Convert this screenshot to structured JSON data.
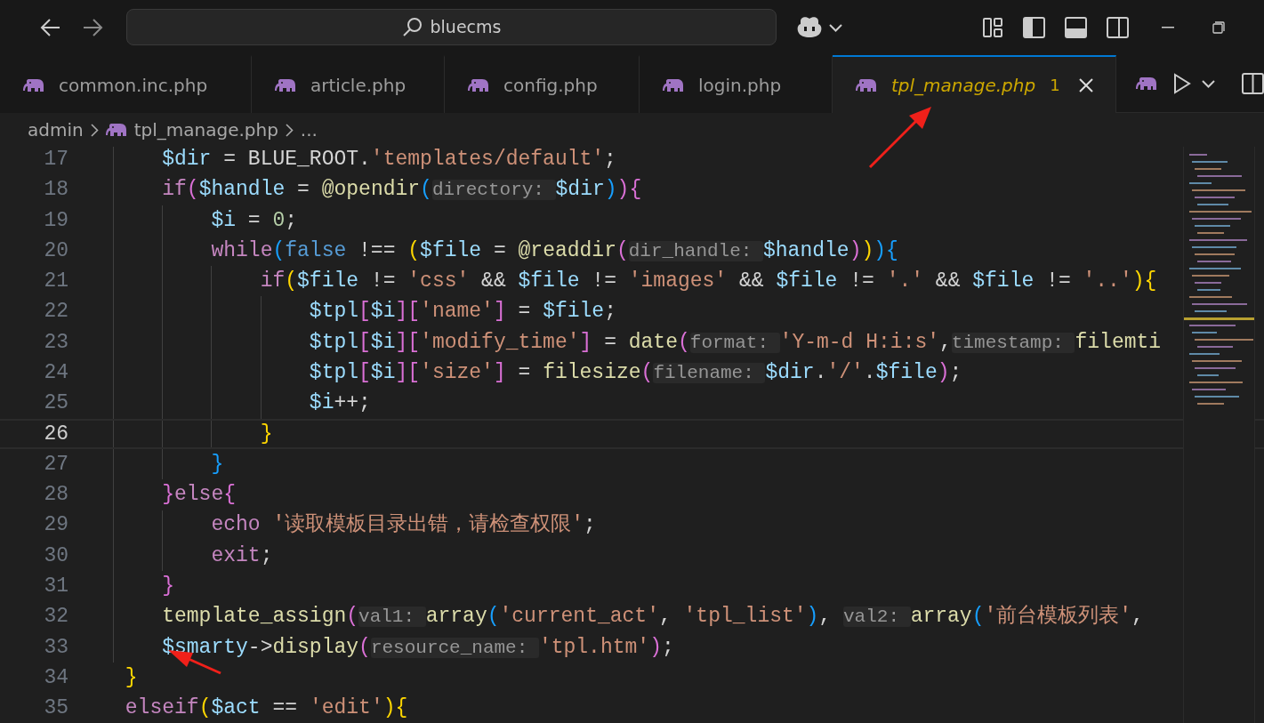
{
  "title_bar": {
    "search": {
      "label": "bluecms"
    }
  },
  "tabs": [
    {
      "label": "common.inc.php",
      "selected": false,
      "preview": false
    },
    {
      "label": "article.php",
      "selected": false,
      "preview": false
    },
    {
      "label": "config.php",
      "selected": false,
      "preview": false
    },
    {
      "label": "login.php",
      "selected": false,
      "preview": false
    },
    {
      "label": "tpl_manage.php",
      "selected": true,
      "preview": true,
      "problems": "1"
    }
  ],
  "breadcrumb": [
    {
      "kind": "folder",
      "label": "admin"
    },
    {
      "kind": "file",
      "label": "tpl_manage.php"
    },
    {
      "kind": "more",
      "label": "..."
    }
  ],
  "editor": {
    "lines": [
      {
        "number": "17",
        "current": false,
        "tokens": [
          {
            "kind": "var",
            "text": "    $dir"
          },
          {
            "kind": "plain",
            "text": " = BLUE_ROOT."
          },
          {
            "kind": "str",
            "text": "'templates/default'"
          },
          {
            "kind": "plain",
            "text": ";"
          }
        ]
      },
      {
        "number": "18",
        "current": false,
        "tokens": [
          {
            "kind": "kw",
            "text": "    if"
          },
          {
            "kind": "b2",
            "text": "("
          },
          {
            "kind": "var",
            "text": "$handle"
          },
          {
            "kind": "plain",
            "text": " = "
          },
          {
            "kind": "fn",
            "text": "@opendir"
          },
          {
            "kind": "b3",
            "text": "("
          },
          {
            "kind": "hint",
            "text": "directory: "
          },
          {
            "kind": "var",
            "text": "$dir"
          },
          {
            "kind": "b3",
            "text": ")"
          },
          {
            "kind": "b2",
            "text": "){"
          }
        ]
      },
      {
        "number": "19",
        "current": false,
        "tokens": [
          {
            "kind": "var",
            "text": "        $i"
          },
          {
            "kind": "plain",
            "text": " = "
          },
          {
            "kind": "num",
            "text": "0"
          },
          {
            "kind": "plain",
            "text": ";"
          }
        ]
      },
      {
        "number": "20",
        "current": false,
        "tokens": [
          {
            "kind": "kw",
            "text": "        while"
          },
          {
            "kind": "b3",
            "text": "("
          },
          {
            "kind": "const",
            "text": "false"
          },
          {
            "kind": "plain",
            "text": " !== "
          },
          {
            "kind": "b1",
            "text": "("
          },
          {
            "kind": "var",
            "text": "$file"
          },
          {
            "kind": "plain",
            "text": " = "
          },
          {
            "kind": "fn",
            "text": "@readdir"
          },
          {
            "kind": "b2",
            "text": "("
          },
          {
            "kind": "hint",
            "text": "dir_handle: "
          },
          {
            "kind": "var",
            "text": "$handle"
          },
          {
            "kind": "b2",
            "text": ")"
          },
          {
            "kind": "b1",
            "text": ")"
          },
          {
            "kind": "b3",
            "text": "){"
          }
        ]
      },
      {
        "number": "21",
        "current": false,
        "tokens": [
          {
            "kind": "kw",
            "text": "            if"
          },
          {
            "kind": "b1",
            "text": "("
          },
          {
            "kind": "var",
            "text": "$file"
          },
          {
            "kind": "plain",
            "text": " != "
          },
          {
            "kind": "str",
            "text": "'css'"
          },
          {
            "kind": "plain",
            "text": " && "
          },
          {
            "kind": "var",
            "text": "$file"
          },
          {
            "kind": "plain",
            "text": " != "
          },
          {
            "kind": "str",
            "text": "'images'"
          },
          {
            "kind": "plain",
            "text": " && "
          },
          {
            "kind": "var",
            "text": "$file"
          },
          {
            "kind": "plain",
            "text": " != "
          },
          {
            "kind": "str",
            "text": "'.'"
          },
          {
            "kind": "plain",
            "text": " && "
          },
          {
            "kind": "var",
            "text": "$file"
          },
          {
            "kind": "plain",
            "text": " != "
          },
          {
            "kind": "str",
            "text": "'..'"
          },
          {
            "kind": "b1",
            "text": "){"
          }
        ]
      },
      {
        "number": "22",
        "current": false,
        "tokens": [
          {
            "kind": "var",
            "text": "                $tpl"
          },
          {
            "kind": "b2",
            "text": "["
          },
          {
            "kind": "var",
            "text": "$i"
          },
          {
            "kind": "b2",
            "text": "]["
          },
          {
            "kind": "str",
            "text": "'name'"
          },
          {
            "kind": "b2",
            "text": "]"
          },
          {
            "kind": "plain",
            "text": " = "
          },
          {
            "kind": "var",
            "text": "$file"
          },
          {
            "kind": "plain",
            "text": ";"
          }
        ]
      },
      {
        "number": "23",
        "current": false,
        "tokens": [
          {
            "kind": "var",
            "text": "                $tpl"
          },
          {
            "kind": "b2",
            "text": "["
          },
          {
            "kind": "var",
            "text": "$i"
          },
          {
            "kind": "b2",
            "text": "]["
          },
          {
            "kind": "str",
            "text": "'modify_time'"
          },
          {
            "kind": "b2",
            "text": "]"
          },
          {
            "kind": "plain",
            "text": " = "
          },
          {
            "kind": "fn",
            "text": "date"
          },
          {
            "kind": "b2",
            "text": "("
          },
          {
            "kind": "hint",
            "text": "format: "
          },
          {
            "kind": "str",
            "text": "'Y-m-d H:i:s'"
          },
          {
            "kind": "plain",
            "text": ","
          },
          {
            "kind": "hint",
            "text": "timestamp: "
          },
          {
            "kind": "fn",
            "text": "filemti"
          }
        ]
      },
      {
        "number": "24",
        "current": false,
        "tokens": [
          {
            "kind": "var",
            "text": "                $tpl"
          },
          {
            "kind": "b2",
            "text": "["
          },
          {
            "kind": "var",
            "text": "$i"
          },
          {
            "kind": "b2",
            "text": "]["
          },
          {
            "kind": "str",
            "text": "'size'"
          },
          {
            "kind": "b2",
            "text": "]"
          },
          {
            "kind": "plain",
            "text": " = "
          },
          {
            "kind": "fn",
            "text": "filesize"
          },
          {
            "kind": "b2",
            "text": "("
          },
          {
            "kind": "hint",
            "text": "filename: "
          },
          {
            "kind": "var",
            "text": "$dir"
          },
          {
            "kind": "plain",
            "text": "."
          },
          {
            "kind": "str",
            "text": "'/'"
          },
          {
            "kind": "plain",
            "text": "."
          },
          {
            "kind": "var",
            "text": "$file"
          },
          {
            "kind": "b2",
            "text": ")"
          },
          {
            "kind": "plain",
            "text": ";"
          }
        ]
      },
      {
        "number": "25",
        "current": false,
        "tokens": [
          {
            "kind": "var",
            "text": "                $i"
          },
          {
            "kind": "plain",
            "text": "++;"
          }
        ]
      },
      {
        "number": "26",
        "current": true,
        "tokens": [
          {
            "kind": "b1",
            "text": "            }"
          }
        ]
      },
      {
        "number": "27",
        "current": false,
        "tokens": [
          {
            "kind": "b3",
            "text": "        }"
          }
        ]
      },
      {
        "number": "28",
        "current": false,
        "tokens": [
          {
            "kind": "b2",
            "text": "    }"
          },
          {
            "kind": "kw",
            "text": "else"
          },
          {
            "kind": "b2",
            "text": "{"
          }
        ]
      },
      {
        "number": "29",
        "current": false,
        "tokens": [
          {
            "kind": "kw",
            "text": "        echo "
          },
          {
            "kind": "str",
            "text": "'读取模板目录出错，请检查权限'"
          },
          {
            "kind": "plain",
            "text": ";"
          }
        ]
      },
      {
        "number": "30",
        "current": false,
        "tokens": [
          {
            "kind": "kw",
            "text": "        exit"
          },
          {
            "kind": "plain",
            "text": ";"
          }
        ]
      },
      {
        "number": "31",
        "current": false,
        "tokens": [
          {
            "kind": "b2",
            "text": "    }"
          }
        ]
      },
      {
        "number": "32",
        "current": false,
        "tokens": [
          {
            "kind": "fn",
            "text": "    template_assign"
          },
          {
            "kind": "b2",
            "text": "("
          },
          {
            "kind": "hint",
            "text": "val1: "
          },
          {
            "kind": "fn",
            "text": "array"
          },
          {
            "kind": "b3",
            "text": "("
          },
          {
            "kind": "str",
            "text": "'current_act'"
          },
          {
            "kind": "plain",
            "text": ", "
          },
          {
            "kind": "str",
            "text": "'tpl_list'"
          },
          {
            "kind": "b3",
            "text": ")"
          },
          {
            "kind": "plain",
            "text": ", "
          },
          {
            "kind": "hint",
            "text": "val2: "
          },
          {
            "kind": "fn",
            "text": "array"
          },
          {
            "kind": "b3",
            "text": "("
          },
          {
            "kind": "str",
            "text": "'前台模板列表'"
          },
          {
            "kind": "plain",
            "text": ","
          }
        ]
      },
      {
        "number": "33",
        "current": false,
        "tokens": [
          {
            "kind": "var",
            "text": "    $smarty"
          },
          {
            "kind": "plain",
            "text": "->"
          },
          {
            "kind": "fn",
            "text": "display"
          },
          {
            "kind": "b2",
            "text": "("
          },
          {
            "kind": "hint",
            "text": "resource_name: "
          },
          {
            "kind": "str",
            "text": "'tpl.htm'"
          },
          {
            "kind": "b2",
            "text": ")"
          },
          {
            "kind": "plain",
            "text": ";"
          }
        ]
      },
      {
        "number": "34",
        "current": false,
        "tokens": [
          {
            "kind": "b1",
            "text": " }"
          }
        ]
      },
      {
        "number": "35",
        "current": false,
        "tokens": [
          {
            "kind": "kw",
            "text": " elseif"
          },
          {
            "kind": "b1",
            "text": "("
          },
          {
            "kind": "var",
            "text": "$act"
          },
          {
            "kind": "plain",
            "text": " == "
          },
          {
            "kind": "str",
            "text": "'edit'"
          },
          {
            "kind": "b1",
            "text": "){"
          }
        ]
      }
    ]
  }
}
